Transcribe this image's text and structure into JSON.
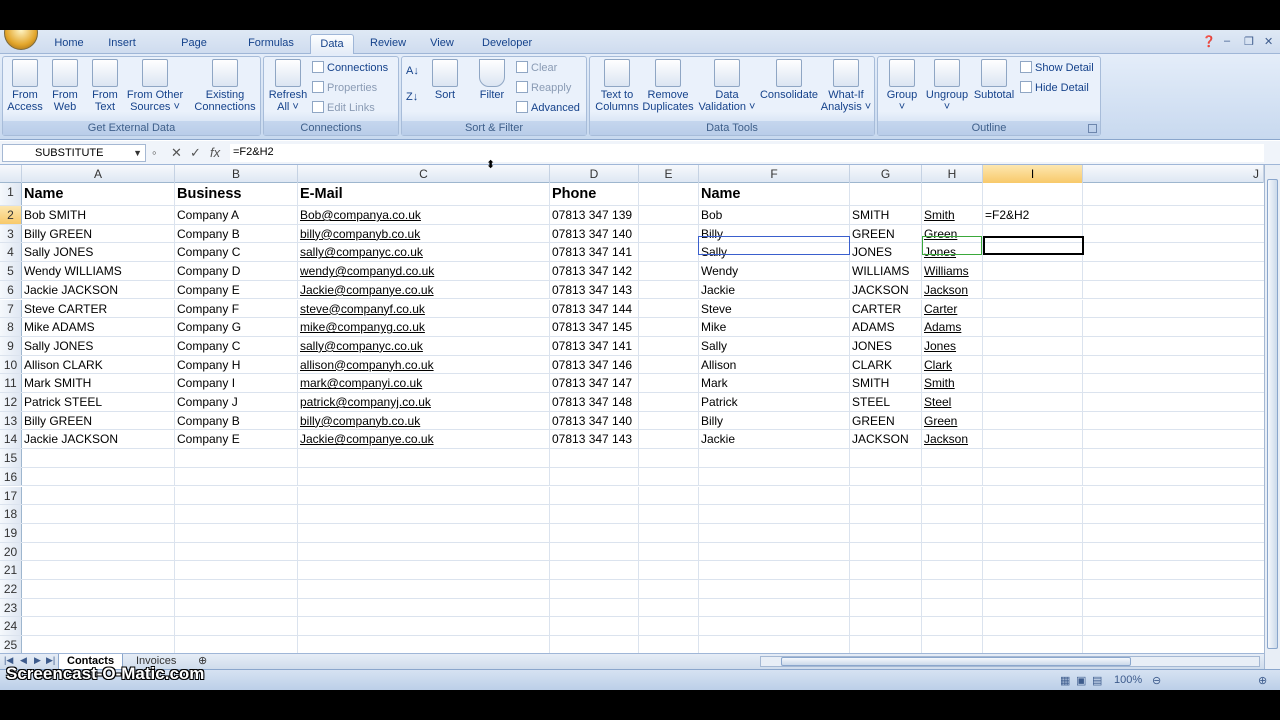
{
  "tabs": [
    "Home",
    "Insert",
    "Page Layout",
    "Formulas",
    "Data",
    "Review",
    "View",
    "Developer"
  ],
  "active_tab": "Data",
  "ribbon": {
    "get_external_data": {
      "label": "Get External Data",
      "buttons": [
        {
          "l1": "From",
          "l2": "Access"
        },
        {
          "l1": "From",
          "l2": "Web"
        },
        {
          "l1": "From",
          "l2": "Text"
        },
        {
          "l1": "From Other",
          "l2": "Sources ˅"
        },
        {
          "l1": "Existing",
          "l2": "Connections"
        }
      ]
    },
    "connections": {
      "label": "Connections",
      "refresh": {
        "l1": "Refresh",
        "l2": "All ˅"
      },
      "items": [
        "Connections",
        "Properties",
        "Edit Links"
      ]
    },
    "sort_filter": {
      "label": "Sort & Filter",
      "sort": "Sort",
      "filter": "Filter",
      "items": [
        "Clear",
        "Reapply",
        "Advanced"
      ]
    },
    "data_tools": {
      "label": "Data Tools",
      "buttons": [
        {
          "l1": "Text to",
          "l2": "Columns"
        },
        {
          "l1": "Remove",
          "l2": "Duplicates"
        },
        {
          "l1": "Data",
          "l2": "Validation ˅"
        },
        {
          "l1": "Consolidate",
          "l2": ""
        },
        {
          "l1": "What-If",
          "l2": "Analysis ˅"
        }
      ]
    },
    "outline": {
      "label": "Outline",
      "buttons": [
        {
          "l1": "Group",
          "l2": "˅"
        },
        {
          "l1": "Ungroup",
          "l2": "˅"
        },
        {
          "l1": "Subtotal",
          "l2": ""
        }
      ],
      "items": [
        "Show Detail",
        "Hide Detail"
      ]
    }
  },
  "formula_bar": {
    "name_box": "SUBSTITUTE",
    "formula": "=F2&H2"
  },
  "columns": [
    "A",
    "B",
    "C",
    "D",
    "E",
    "F",
    "G",
    "H",
    "I",
    "J"
  ],
  "rows": [
    {
      "n": "1",
      "A": "Name",
      "B": "Business",
      "C": "E-Mail",
      "D": "Phone",
      "E": "",
      "F": "Name",
      "G": "",
      "H": "",
      "I": ""
    },
    {
      "n": "2",
      "A": "Bob SMITH",
      "B": "Company A",
      "C": "Bob@companya.co.uk",
      "D": "07813 347 139",
      "E": "",
      "F": "Bob",
      "G": "SMITH",
      "H": "Smith",
      "I": "=F2&H2"
    },
    {
      "n": "3",
      "A": "Billy GREEN",
      "B": "Company B",
      "C": "billy@companyb.co.uk",
      "D": "07813 347 140",
      "E": "",
      "F": "Billy",
      "G": "GREEN",
      "H": "Green",
      "I": ""
    },
    {
      "n": "4",
      "A": "Sally JONES",
      "B": "Company C",
      "C": "sally@companyc.co.uk",
      "D": "07813 347 141",
      "E": "",
      "F": "Sally",
      "G": "JONES",
      "H": "Jones",
      "I": ""
    },
    {
      "n": "5",
      "A": "Wendy WILLIAMS",
      "B": "Company D",
      "C": "wendy@companyd.co.uk",
      "D": "07813 347 142",
      "E": "",
      "F": "Wendy",
      "G": "WILLIAMS",
      "H": "Williams",
      "I": ""
    },
    {
      "n": "6",
      "A": "Jackie JACKSON",
      "B": "Company E",
      "C": "Jackie@companye.co.uk",
      "D": "07813 347 143",
      "E": "",
      "F": "Jackie",
      "G": "JACKSON",
      "H": "Jackson",
      "I": ""
    },
    {
      "n": "7",
      "A": "Steve CARTER",
      "B": "Company F",
      "C": "steve@companyf.co.uk",
      "D": "07813 347 144",
      "E": "",
      "F": "Steve",
      "G": "CARTER",
      "H": "Carter",
      "I": ""
    },
    {
      "n": "8",
      "A": "Mike ADAMS",
      "B": "Company G",
      "C": "mike@companyg.co.uk",
      "D": "07813 347 145",
      "E": "",
      "F": "Mike",
      "G": "ADAMS",
      "H": "Adams",
      "I": ""
    },
    {
      "n": "9",
      "A": "Sally JONES",
      "B": "Company C",
      "C": "sally@companyc.co.uk",
      "D": "07813 347 141",
      "E": "",
      "F": "Sally",
      "G": "JONES",
      "H": "Jones",
      "I": ""
    },
    {
      "n": "10",
      "A": "Allison CLARK",
      "B": "Company H",
      "C": "allison@companyh.co.uk",
      "D": "07813 347 146",
      "E": "",
      "F": "Allison",
      "G": "CLARK",
      "H": "Clark",
      "I": ""
    },
    {
      "n": "11",
      "A": "Mark SMITH",
      "B": "Company I",
      "C": "mark@companyi.co.uk",
      "D": "07813 347 147",
      "E": "",
      "F": "Mark",
      "G": "SMITH",
      "H": "Smith",
      "I": ""
    },
    {
      "n": "12",
      "A": "Patrick STEEL",
      "B": "Company J",
      "C": "patrick@companyj.co.uk",
      "D": "07813 347 148",
      "E": "",
      "F": "Patrick",
      "G": "STEEL",
      "H": "Steel",
      "I": ""
    },
    {
      "n": "13",
      "A": "Billy GREEN",
      "B": "Company B",
      "C": "billy@companyb.co.uk",
      "D": "07813 347 140",
      "E": "",
      "F": "Billy",
      "G": "GREEN",
      "H": "Green",
      "I": ""
    },
    {
      "n": "14",
      "A": "Jackie JACKSON",
      "B": "Company E",
      "C": "Jackie@companye.co.uk",
      "D": "07813 347 143",
      "E": "",
      "F": "Jackie",
      "G": "JACKSON",
      "H": "Jackson",
      "I": ""
    },
    {
      "n": "15"
    },
    {
      "n": "16"
    },
    {
      "n": "17"
    },
    {
      "n": "18"
    },
    {
      "n": "19"
    },
    {
      "n": "20"
    },
    {
      "n": "21"
    },
    {
      "n": "22"
    },
    {
      "n": "23"
    },
    {
      "n": "24"
    },
    {
      "n": "25"
    }
  ],
  "sheets": [
    "Contacts",
    "Invoices"
  ],
  "active_sheet": "Contacts",
  "zoom": "100%",
  "watermark": "Screencast-O-Matic.com"
}
